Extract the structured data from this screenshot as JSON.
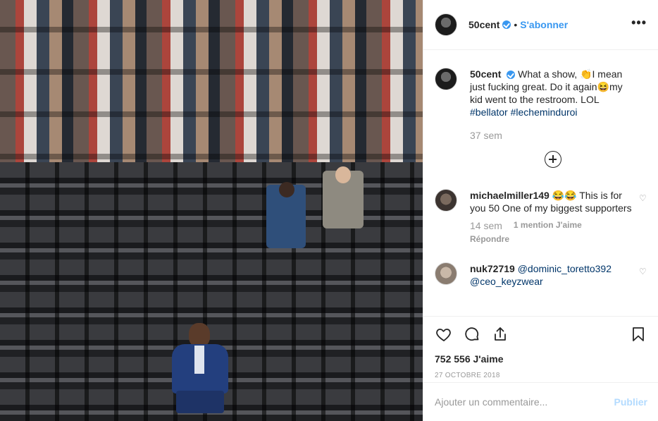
{
  "header": {
    "username": "50cent",
    "follow_label": "S'abonner",
    "separator": "•",
    "more_icon": "more-icon"
  },
  "caption": {
    "username": "50cent",
    "text_before": "What a show, 👏I mean just fucking great. Do it again😆my kid went to the restroom. LOL ",
    "hashtag1": "#bellator",
    "hashtag2": "#lecheminduroi",
    "time": "37 sem"
  },
  "comments": [
    {
      "username": "michaelmiller149",
      "text": "😂😂 This is for you 50 One of my biggest supporters",
      "time": "14 sem",
      "likes": "1 mention J'aime",
      "reply": "Répondre"
    },
    {
      "username": "nuk72719",
      "mention1": "@dominic_toretto392",
      "mention2": "@ceo_keyzwear"
    }
  ],
  "actions": {
    "likes": "752 556 J'aime",
    "date": "27 OCTOBRE 2018"
  },
  "add_comment": {
    "placeholder": "Ajouter un commentaire...",
    "publish": "Publier"
  },
  "colors": {
    "accent": "#3897f0",
    "publish_disabled": "#b3dbff",
    "muted": "#999999",
    "link": "#003569"
  }
}
